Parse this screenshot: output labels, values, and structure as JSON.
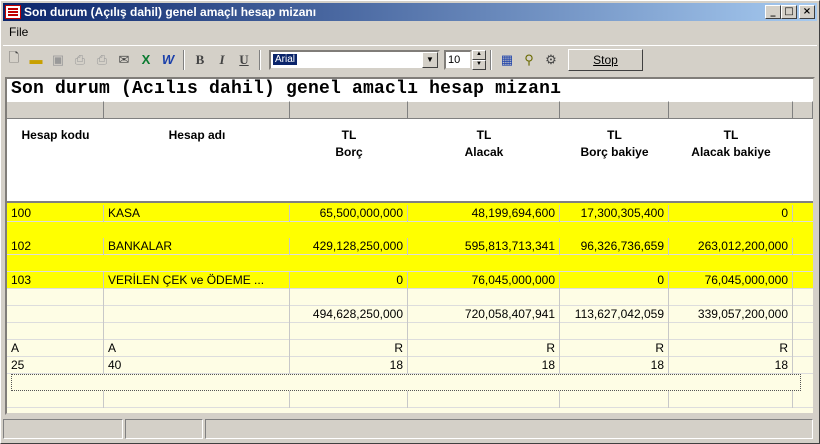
{
  "window": {
    "title": "Son durum (Açılış dahil) genel amaçlı hesap mizanı",
    "minimize": "_",
    "maximize": "□",
    "close": "×"
  },
  "menu": {
    "file": "File"
  },
  "toolbar": {
    "bold": "B",
    "italic": "I",
    "underline": "U",
    "font_name": "Arial",
    "font_size": "10",
    "stop": "Stop"
  },
  "report": {
    "title": "Son durum (Acılıs dahil) genel amaclı hesap mizanı",
    "headers": {
      "code": "Hesap kodu",
      "name": "Hesap adı",
      "debit_top": "TL",
      "debit": "Borç",
      "credit_top": "TL",
      "credit": "Alacak",
      "debit_bal_top": "TL",
      "debit_bal": "Borç bakiye",
      "credit_bal_top": "TL",
      "credit_bal": "Alacak bakiye"
    },
    "rows": [
      {
        "code": "100",
        "name": "KASA",
        "debit": "65,500,000,000",
        "credit": "48,199,694,600",
        "debit_bal": "17,300,305,400",
        "credit_bal": "0"
      },
      {
        "code": "102",
        "name": "BANKALAR",
        "debit": "429,128,250,000",
        "credit": "595,813,713,341",
        "debit_bal": "96,326,736,659",
        "credit_bal": "263,012,200,000"
      },
      {
        "code": "103",
        "name": "VERİLEN ÇEK ve ÖDEME ...",
        "debit": "0",
        "credit": "76,045,000,000",
        "debit_bal": "0",
        "credit_bal": "76,045,000,000"
      }
    ],
    "totals": {
      "debit": "494,628,250,000",
      "credit": "720,058,407,941",
      "debit_bal": "113,627,042,059",
      "credit_bal": "339,057,200,000"
    },
    "align_row": {
      "code": "A",
      "name": "A",
      "debit": "R",
      "credit": "R",
      "debit_bal": "R",
      "credit_bal": "R"
    },
    "width_row": {
      "code": "25",
      "name": "40",
      "debit": "18",
      "credit": "18",
      "debit_bal": "18",
      "credit_bal": "18"
    }
  },
  "colors": {
    "highlight": "#ffff00",
    "grid_bg": "#fefde5",
    "title_bar": "#0a246a"
  }
}
